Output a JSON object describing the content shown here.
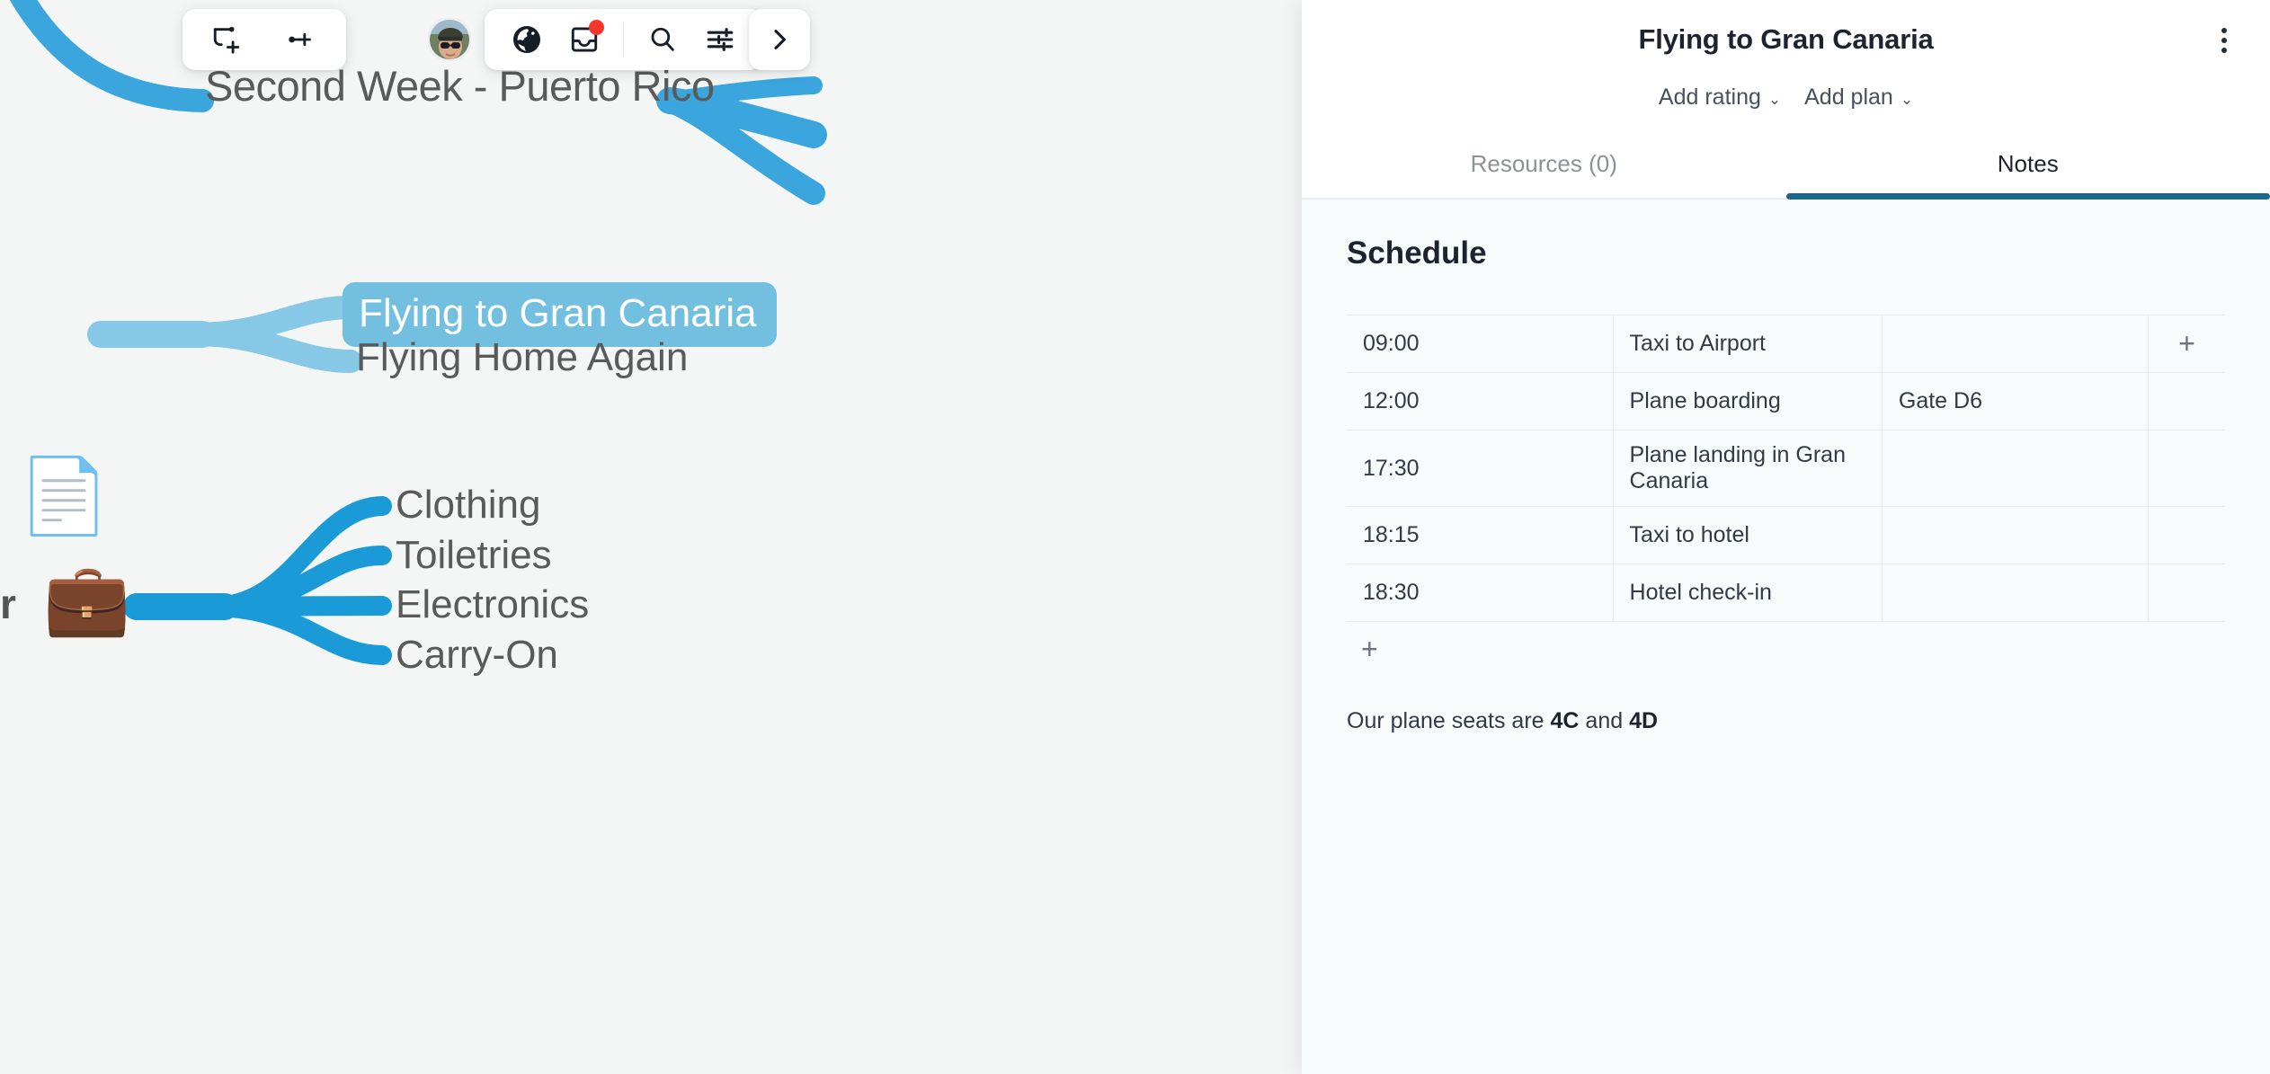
{
  "toolbar": {
    "left_group": [
      {
        "name": "add-subtopic-icon",
        "label": "Add subtopic"
      },
      {
        "name": "add-sibling-topic-icon",
        "label": "Add sibling topic"
      }
    ],
    "right_group": [
      {
        "name": "globe-icon",
        "label": "Share / publish"
      },
      {
        "name": "inbox-icon",
        "label": "Inbox",
        "badge": true
      },
      {
        "name": "search-icon",
        "label": "Search"
      },
      {
        "name": "sliders-icon",
        "label": "Settings"
      }
    ],
    "collapse": {
      "name": "chevron-right-icon",
      "label": "Collapse panel"
    },
    "avatar_label": "User avatar"
  },
  "mindmap": {
    "nodes": [
      {
        "id": "second-week",
        "text": "Second Week - Puerto Rico",
        "selected": false
      },
      {
        "id": "flying-gran",
        "text": "Flying to Gran Canaria",
        "selected": true
      },
      {
        "id": "flying-home",
        "text": "Flying Home Again",
        "selected": false
      },
      {
        "id": "clothing",
        "text": "Clothing",
        "selected": false
      },
      {
        "id": "toiletries",
        "text": "Toiletries",
        "selected": false
      },
      {
        "id": "electronics",
        "text": "Electronics",
        "selected": false
      },
      {
        "id": "carry-on",
        "text": "Carry-On",
        "selected": false
      },
      {
        "id": "partial-left",
        "text": "r",
        "selected": false
      }
    ],
    "icons": [
      {
        "id": "doc",
        "name": "document-icon",
        "glyph": "📄"
      },
      {
        "id": "briefcase",
        "name": "briefcase-icon",
        "glyph": "💼"
      }
    ],
    "branch_color": "#1b9ad8",
    "branch_color_light": "#72bfe0",
    "background": "#f4f6f6"
  },
  "panel": {
    "title": "Flying to Gran Canaria",
    "kebab_label": "More options",
    "actions": [
      {
        "label": "Add rating",
        "caret": "⌄"
      },
      {
        "label": "Add plan",
        "caret": "⌄"
      }
    ],
    "tabs": [
      {
        "label": "Resources (0)",
        "active": false
      },
      {
        "label": "Notes",
        "active": true
      }
    ],
    "accent_color": "#19678f",
    "notes": {
      "heading": "Schedule",
      "table": {
        "columns": [
          "time",
          "activity",
          "note",
          "add"
        ],
        "rows": [
          {
            "time": "09:00",
            "activity": "Taxi to Airport",
            "note": "",
            "add": "+"
          },
          {
            "time": "12:00",
            "activity": "Plane boarding",
            "note": "Gate D6",
            "add": ""
          },
          {
            "time": "17:30",
            "activity": "Plane landing in Gran Canaria",
            "note": "",
            "add": ""
          },
          {
            "time": "18:15",
            "activity": "Taxi to hotel",
            "note": "",
            "add": ""
          },
          {
            "time": "18:30",
            "activity": "Hotel check-in",
            "note": "",
            "add": ""
          }
        ],
        "add_row_label": "+"
      },
      "paragraph_prefix": "Our plane seats are ",
      "paragraph_seat_1": "4C",
      "paragraph_middle": " and ",
      "paragraph_seat_2": "4D"
    }
  }
}
